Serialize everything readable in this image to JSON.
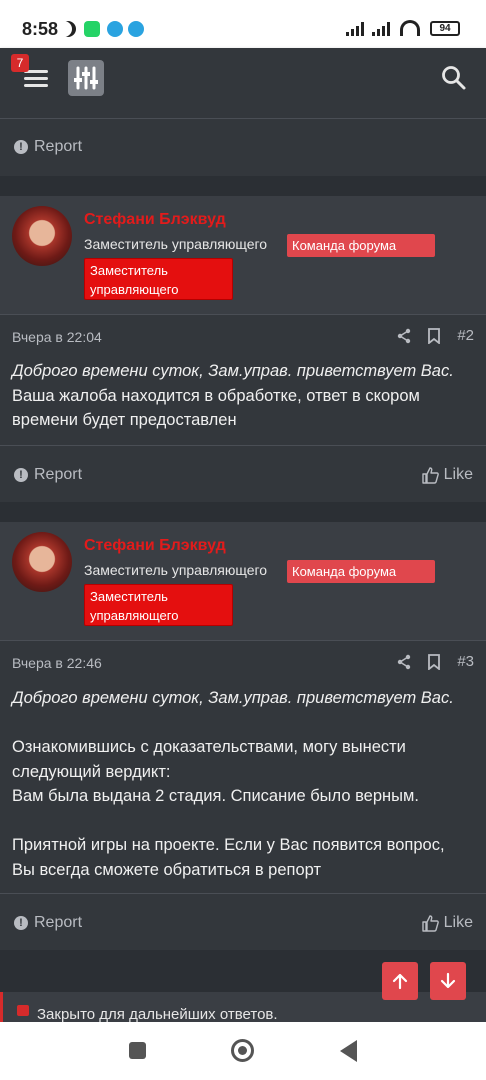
{
  "status_bar": {
    "time": "8:58",
    "battery": "94"
  },
  "header": {
    "notification_count": "7"
  },
  "prev_footer": {
    "report_label": "Report"
  },
  "posts": [
    {
      "author": "Стефани Блэквуд",
      "user_title": "Заместитель управляющего",
      "banner_team": "Команда форума",
      "banner_role": "Заместитель управляющего",
      "date": "Вчера в 22:04",
      "number": "#2",
      "lines": [
        "Доброго времени суток, Зам.управ. приветствует Вас.",
        "Ваша жалоба находится в обработке, ответ в скором",
        "времени будет предоставлен"
      ],
      "report_label": "Report",
      "like_label": "Like"
    },
    {
      "author": "Стефани Блэквуд",
      "user_title": "Заместитель управляющего",
      "banner_team": "Команда форума",
      "banner_role": "Заместитель управляющего",
      "date": "Вчера в 22:46",
      "number": "#3",
      "lines": [
        "Доброго времени суток, Зам.управ. приветствует Вас.",
        "",
        "Ознакомившись с доказательствами, могу вынести",
        "следующий вердикт:",
        "Вам была выдана 2 стадия. Списание было верным.",
        "",
        "Приятной игры на проекте. Если у Вас появится вопрос,",
        "Вы всегда сможете обратиться в репорт"
      ],
      "report_label": "Report",
      "like_label": "Like"
    }
  ],
  "closed_notice": "Закрыто для дальнейших ответов."
}
